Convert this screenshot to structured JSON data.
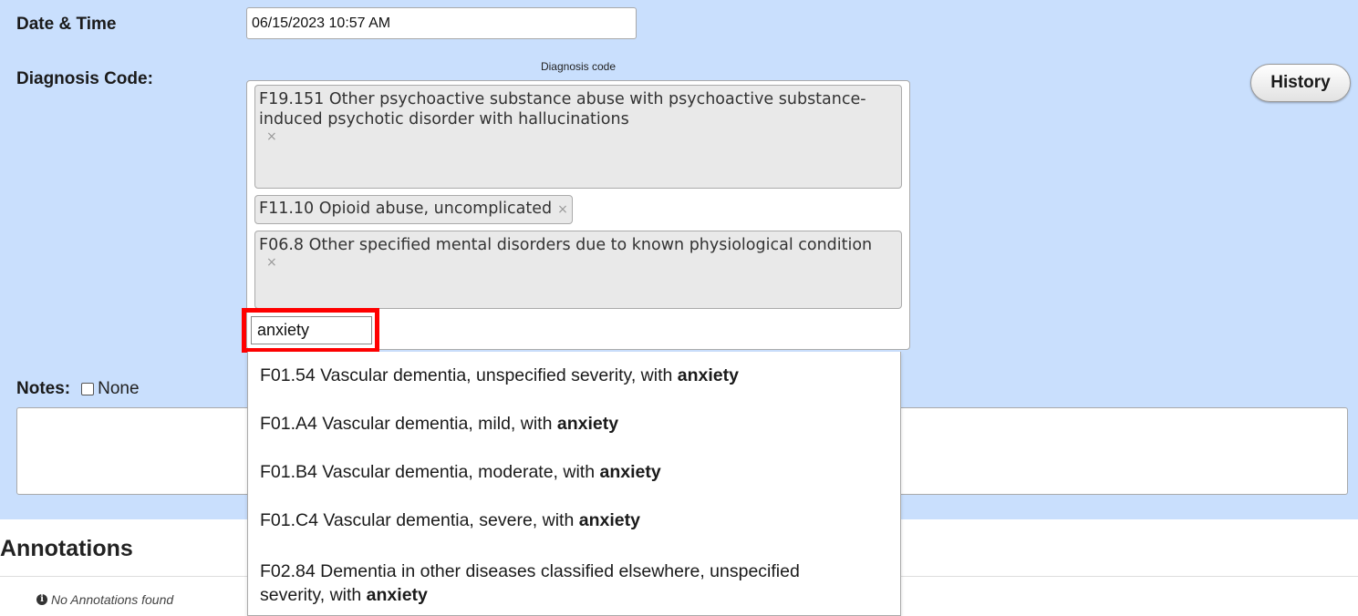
{
  "form": {
    "date_time_label": "Date & Time",
    "date_time_value": "06/15/2023 10:57 AM",
    "diagnosis_label": "Diagnosis Code:",
    "diagnosis_caption": "Diagnosis code",
    "history_button": "History",
    "selected_codes": [
      {
        "text": "F19.151 Other psychoactive substance abuse with psychoactive substance-induced psychotic disorder with hallucinations",
        "remove": "×"
      },
      {
        "text": "F11.10 Opioid abuse, uncomplicated",
        "remove": "×"
      },
      {
        "text": "F06.8 Other specified mental disorders due to known physiological condition",
        "remove": "×"
      }
    ],
    "search_value": "anxiety",
    "notes_label": "Notes:",
    "notes_none_label": "None",
    "notes_value": ""
  },
  "dropdown": {
    "highlight_term": "anxiety",
    "options": [
      {
        "prefix": "F01.54 Vascular dementia, unspecified severity, with ",
        "match": "anxiety"
      },
      {
        "prefix": "F01.A4 Vascular dementia, mild, with ",
        "match": "anxiety"
      },
      {
        "prefix": "F01.B4 Vascular dementia, moderate, with ",
        "match": "anxiety"
      },
      {
        "prefix": "F01.C4 Vascular dementia, severe, with ",
        "match": "anxiety"
      },
      {
        "prefix": "F02.84 Dementia in other diseases classified elsewhere, unspecified severity, with ",
        "match": "anxiety"
      }
    ]
  },
  "annotations": {
    "title": "Annotations",
    "empty_message": "No Annotations found",
    "info_icon": "info-circle-icon"
  },
  "colors": {
    "panel_bg": "#c9dffd",
    "highlight_border": "#ff0000"
  }
}
